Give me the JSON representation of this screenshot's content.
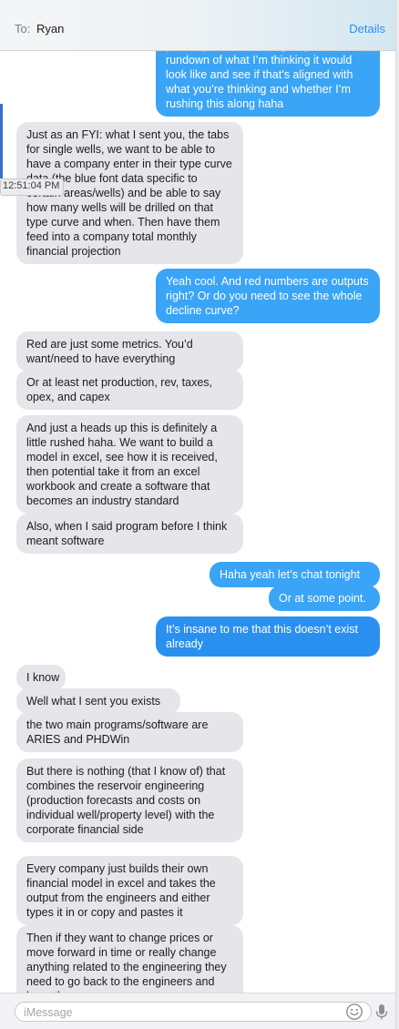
{
  "header": {
    "to_label": "To:",
    "recipient": "Ryan",
    "details_label": "Details"
  },
  "timestamp": "12:51:04 PM",
  "messages": [
    {
      "side": "out",
      "text": "perfectly – but wanted give you a rundown of what I’m thinking it would look like and see if that’s aligned with what you’re thinking and whether I’m rushing this along haha"
    },
    {
      "side": "in",
      "text": "Just as an FYI: what I sent you, the tabs for single wells, we want to be able to have a company enter in their type curve data (the blue font data specific to certain areas/wells) and be able to say how many wells will be drilled on that type curve and when. Then have them feed into a company total monthly financial projection"
    },
    {
      "side": "out",
      "text": "Yeah cool. And red numbers are outputs right? Or do you need to see the whole decline curve?"
    },
    {
      "side": "in",
      "text": "Red are just some metrics. You’d want/need to have everything"
    },
    {
      "side": "in",
      "text": "Or at least net production, rev, taxes, opex, and capex"
    },
    {
      "side": "in",
      "text": "And just a heads up this is definitely a little rushed haha. We want to build a model in excel, see how it is received, then potential take it from an excel workbook and create a software that becomes an industry standard"
    },
    {
      "side": "in",
      "text": "Also, when I said program before I think meant software"
    },
    {
      "side": "out",
      "text": "Haha yeah let’s chat tonight"
    },
    {
      "side": "out",
      "text": "Or at some point."
    },
    {
      "side": "out",
      "text": "It’s insane to me that this doesn’t exist already"
    },
    {
      "side": "in",
      "text": "I know"
    },
    {
      "side": "in",
      "text": "Well what I sent you exists"
    },
    {
      "side": "in",
      "text": "the two main programs/software are ARIES and PHDWin"
    },
    {
      "side": "in",
      "text": "But there is nothing (that I know of) that combines the reservoir engineering (production forecasts and costs on individual well/property level) with the corporate financial side"
    },
    {
      "side": "in",
      "text": "Every company just builds their own financial model in excel and takes the output from the engineers and either types it in or copy and pastes it"
    },
    {
      "side": "in",
      "text": "Then if they want to change prices or move forward in time or really change anything related to the engineering they need to go back to the engineers and have them..."
    }
  ],
  "composer": {
    "placeholder": "iMessage"
  },
  "icons": {
    "emoji": "emoji-icon",
    "microphone": "microphone-icon"
  },
  "colors": {
    "outgoing_bubble": "#3aa4f6",
    "incoming_bubble": "#e5e5ea",
    "link": "#2a8ff4"
  }
}
